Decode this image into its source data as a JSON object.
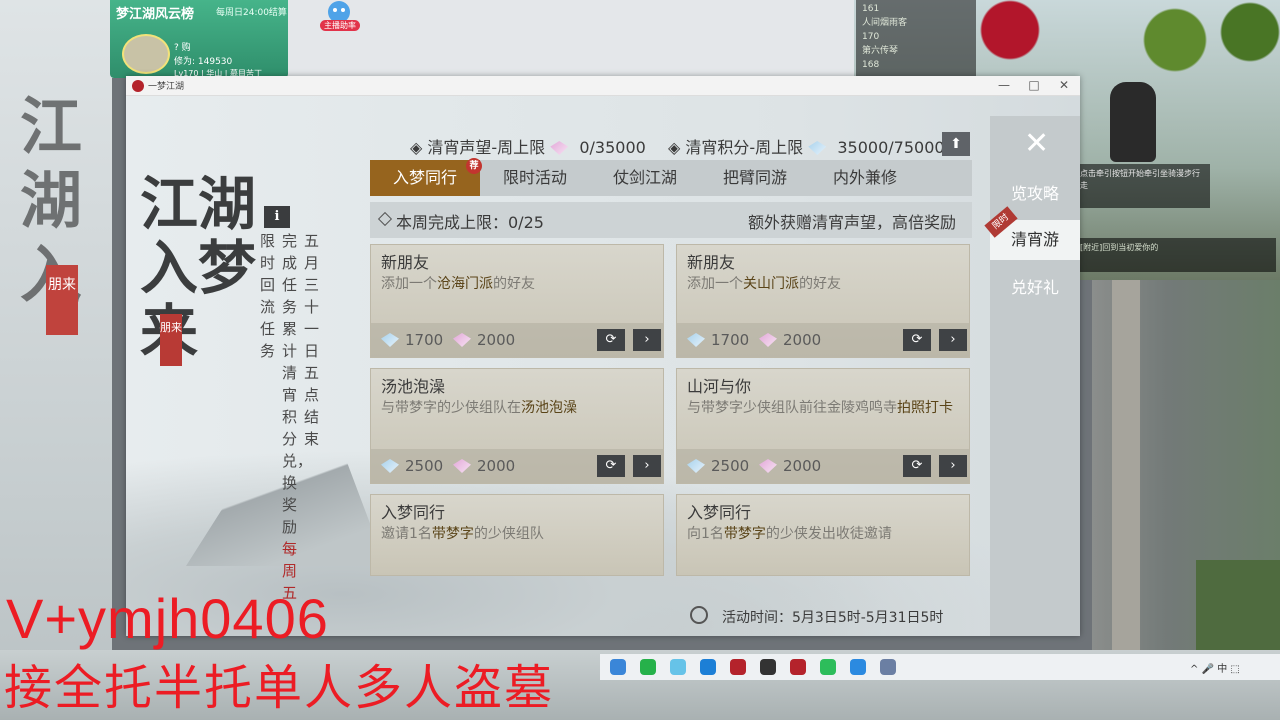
{
  "colors": {
    "accent": "#96641e",
    "badge": "#c2352f",
    "overlay_text": "#ec1c24"
  },
  "background": {
    "left_calligraphy": "江湖入",
    "left_stamp": "朋来",
    "rank": {
      "title": "梦江湖风云榜",
      "refresh": "每周日24:00结算",
      "name": "? 购",
      "power": "修为: 149530",
      "level": "Lv170 | 华山 | 慕目苦丁"
    },
    "anchor_label": "主播助率",
    "hud": [
      "161",
      "人间烟雨客",
      "170",
      "第六传琴",
      "168"
    ],
    "chat": [
      "点击牵引按钮开始牵引坐骑漫步行",
      "走"
    ],
    "chat2": [
      "[附近]回到当初爱你的"
    ]
  },
  "overlay": {
    "line1": "V+ymjh0406",
    "line2": "接全托半托单人多人盗墓"
  },
  "window": {
    "title": "一梦江湖",
    "minimize": "—",
    "maximize": "□",
    "close": "✕"
  },
  "game": {
    "calligraphy": "江湖入梦来",
    "stamp": "朋来",
    "info_icon": "i",
    "rules": {
      "col1": "五月三十一日五点结束",
      "col2": "完成任务累计清宵积分兑，换奖励",
      "col2_red": "每周五",
      "col3": "限时回流任务"
    },
    "stats": {
      "label1": "◈ 清宵声望-周上限",
      "value1": "0/35000",
      "label2": "◈ 清宵积分-周上限",
      "value2": "35000/75000",
      "up_icon": "⬆"
    },
    "tabs": [
      "入梦同行",
      "限时活动",
      "仗剑江湖",
      "把臂同游",
      "内外兼修"
    ],
    "tab_badge": "荐",
    "weekly": {
      "label": "本周完成上限：0/25",
      "extra": "额外获赠清宵声望，高倍奖励"
    },
    "cards": [
      {
        "title": "新朋友",
        "desc_pre": "添加一个",
        "desc_hl": "沧海门派",
        "desc_post": "的好友",
        "r1": "1700",
        "r2": "2000"
      },
      {
        "title": "新朋友",
        "desc_pre": "添加一个",
        "desc_hl": "关山门派",
        "desc_post": "的好友",
        "r1": "1700",
        "r2": "2000"
      },
      {
        "title": "汤池泡澡",
        "desc_pre": "与带梦字的少侠组队在",
        "desc_hl": "汤池泡澡",
        "desc_post": "",
        "r1": "2500",
        "r2": "2000"
      },
      {
        "title": "山河与你",
        "desc_pre": "与带梦字少侠组队前往金陵鸡鸣寺",
        "desc_hl": "拍照打卡",
        "desc_post": "",
        "r1": "2500",
        "r2": "2000"
      },
      {
        "title": "入梦同行",
        "desc_pre": "邀请1名",
        "desc_hl": "带梦字",
        "desc_post": "的少侠组队"
      },
      {
        "title": "入梦同行",
        "desc_pre": "向1名",
        "desc_hl": "带梦字",
        "desc_post": "的少侠发出收徒邀请"
      }
    ],
    "refresh_icon": "⟳",
    "go_icon": "›",
    "side": {
      "close": "✕",
      "items": [
        "览攻略",
        "清宵游",
        "兑好礼"
      ],
      "tag": "限时"
    },
    "period": "活动时间：5月3日5时-5月31日5时"
  },
  "tray": "^  🎤  中  ⬚"
}
